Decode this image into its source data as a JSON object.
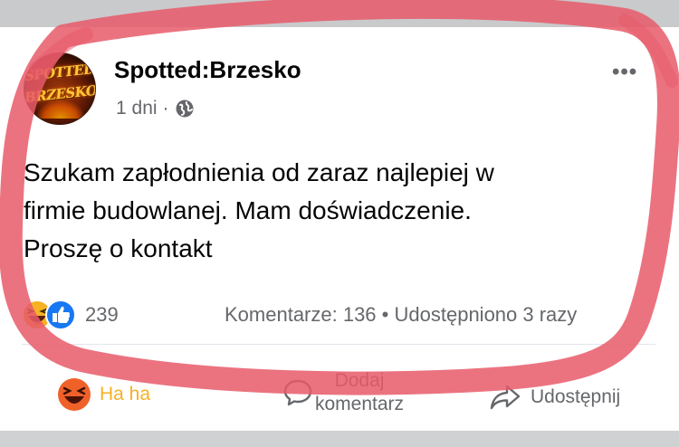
{
  "post": {
    "page_name": "Spotted:Brzesko",
    "avatar_text": [
      "SPOTTED",
      "BRZESKO"
    ],
    "time": "1 dni",
    "separator": "·",
    "more_label": "•••",
    "text_lines": [
      "Szukam zapłodnienia od zaraz  najlepiej w",
      "firmie budowlanej. Mam doświadczenie.",
      "Proszę o kontakt"
    ]
  },
  "reactions": {
    "count": "239",
    "comments_label": "Komentarze: 136",
    "dot": "•",
    "shares_label": "Udostępniono 3 razy"
  },
  "actions": {
    "haha_label": "Ha ha",
    "comment_label_line1": "Dodaj",
    "comment_label_line2": "komentarz",
    "share_label": "Udostępnij"
  },
  "colors": {
    "annotation_circle": "#e85a6a",
    "haha_active": "#f7b125",
    "like_blue": "#1877f2",
    "text_primary": "#050505",
    "text_secondary": "#65676b"
  },
  "icons": [
    "globe-icon",
    "more-options-icon",
    "haha-reaction-icon",
    "like-reaction-icon",
    "comment-icon",
    "share-icon"
  ]
}
